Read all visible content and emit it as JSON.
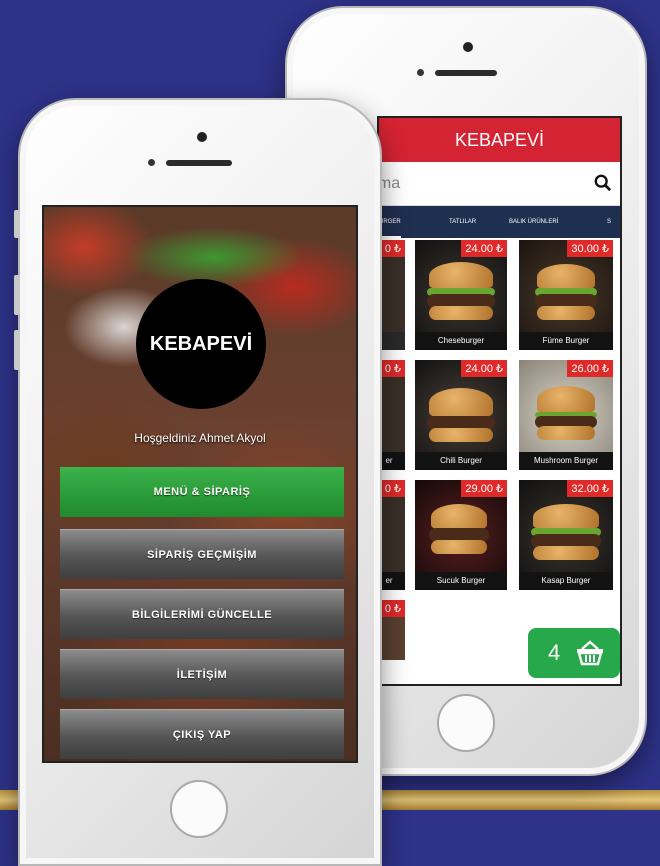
{
  "back_phone": {
    "app_title": "KEBAPEVİ",
    "search": {
      "value": "ama"
    },
    "categories": [
      {
        "label": "BURGER",
        "active": true
      },
      {
        "label": "TATLILAR",
        "active": false
      },
      {
        "label": "BALIK ÜRÜNLERİ",
        "active": false
      },
      {
        "label": "S",
        "active": false
      }
    ],
    "products": [
      {
        "name": "",
        "price": "0 ₺"
      },
      {
        "name": "Cheseburger",
        "price": "24.00 ₺"
      },
      {
        "name": "Füme Burger",
        "price": "30.00 ₺"
      },
      {
        "name": "er",
        "price": "0 ₺"
      },
      {
        "name": "Chili Burger",
        "price": "24.00 ₺"
      },
      {
        "name": "Mushroom Burger",
        "price": "26.00 ₺"
      },
      {
        "name": "er",
        "price": "0 ₺"
      },
      {
        "name": "Sucuk Burger",
        "price": "29.00 ₺"
      },
      {
        "name": "Kasap Burger",
        "price": "32.00 ₺"
      },
      {
        "name": "",
        "price": "0 ₺"
      }
    ],
    "cart_count": "4",
    "cart_icon": "basket-icon"
  },
  "front_phone": {
    "logo_text": "KEBAPEVİ",
    "welcome": "Hoşgeldiniz Ahmet Akyol",
    "menu": [
      {
        "label": "MENÜ & SİPARİŞ",
        "style": "green"
      },
      {
        "label": "SİPARİŞ GEÇMİŞİM",
        "style": "gray"
      },
      {
        "label": "BİLGİLERİMİ GÜNCELLE",
        "style": "gray"
      },
      {
        "label": "İLETİŞİM",
        "style": "gray"
      },
      {
        "label": "ÇIKIŞ YAP",
        "style": "gray"
      }
    ]
  },
  "colors": {
    "background": "#2e3289",
    "accent_red": "#d42333",
    "accent_green": "#27a84a",
    "category_bar": "#1f2f4f"
  }
}
